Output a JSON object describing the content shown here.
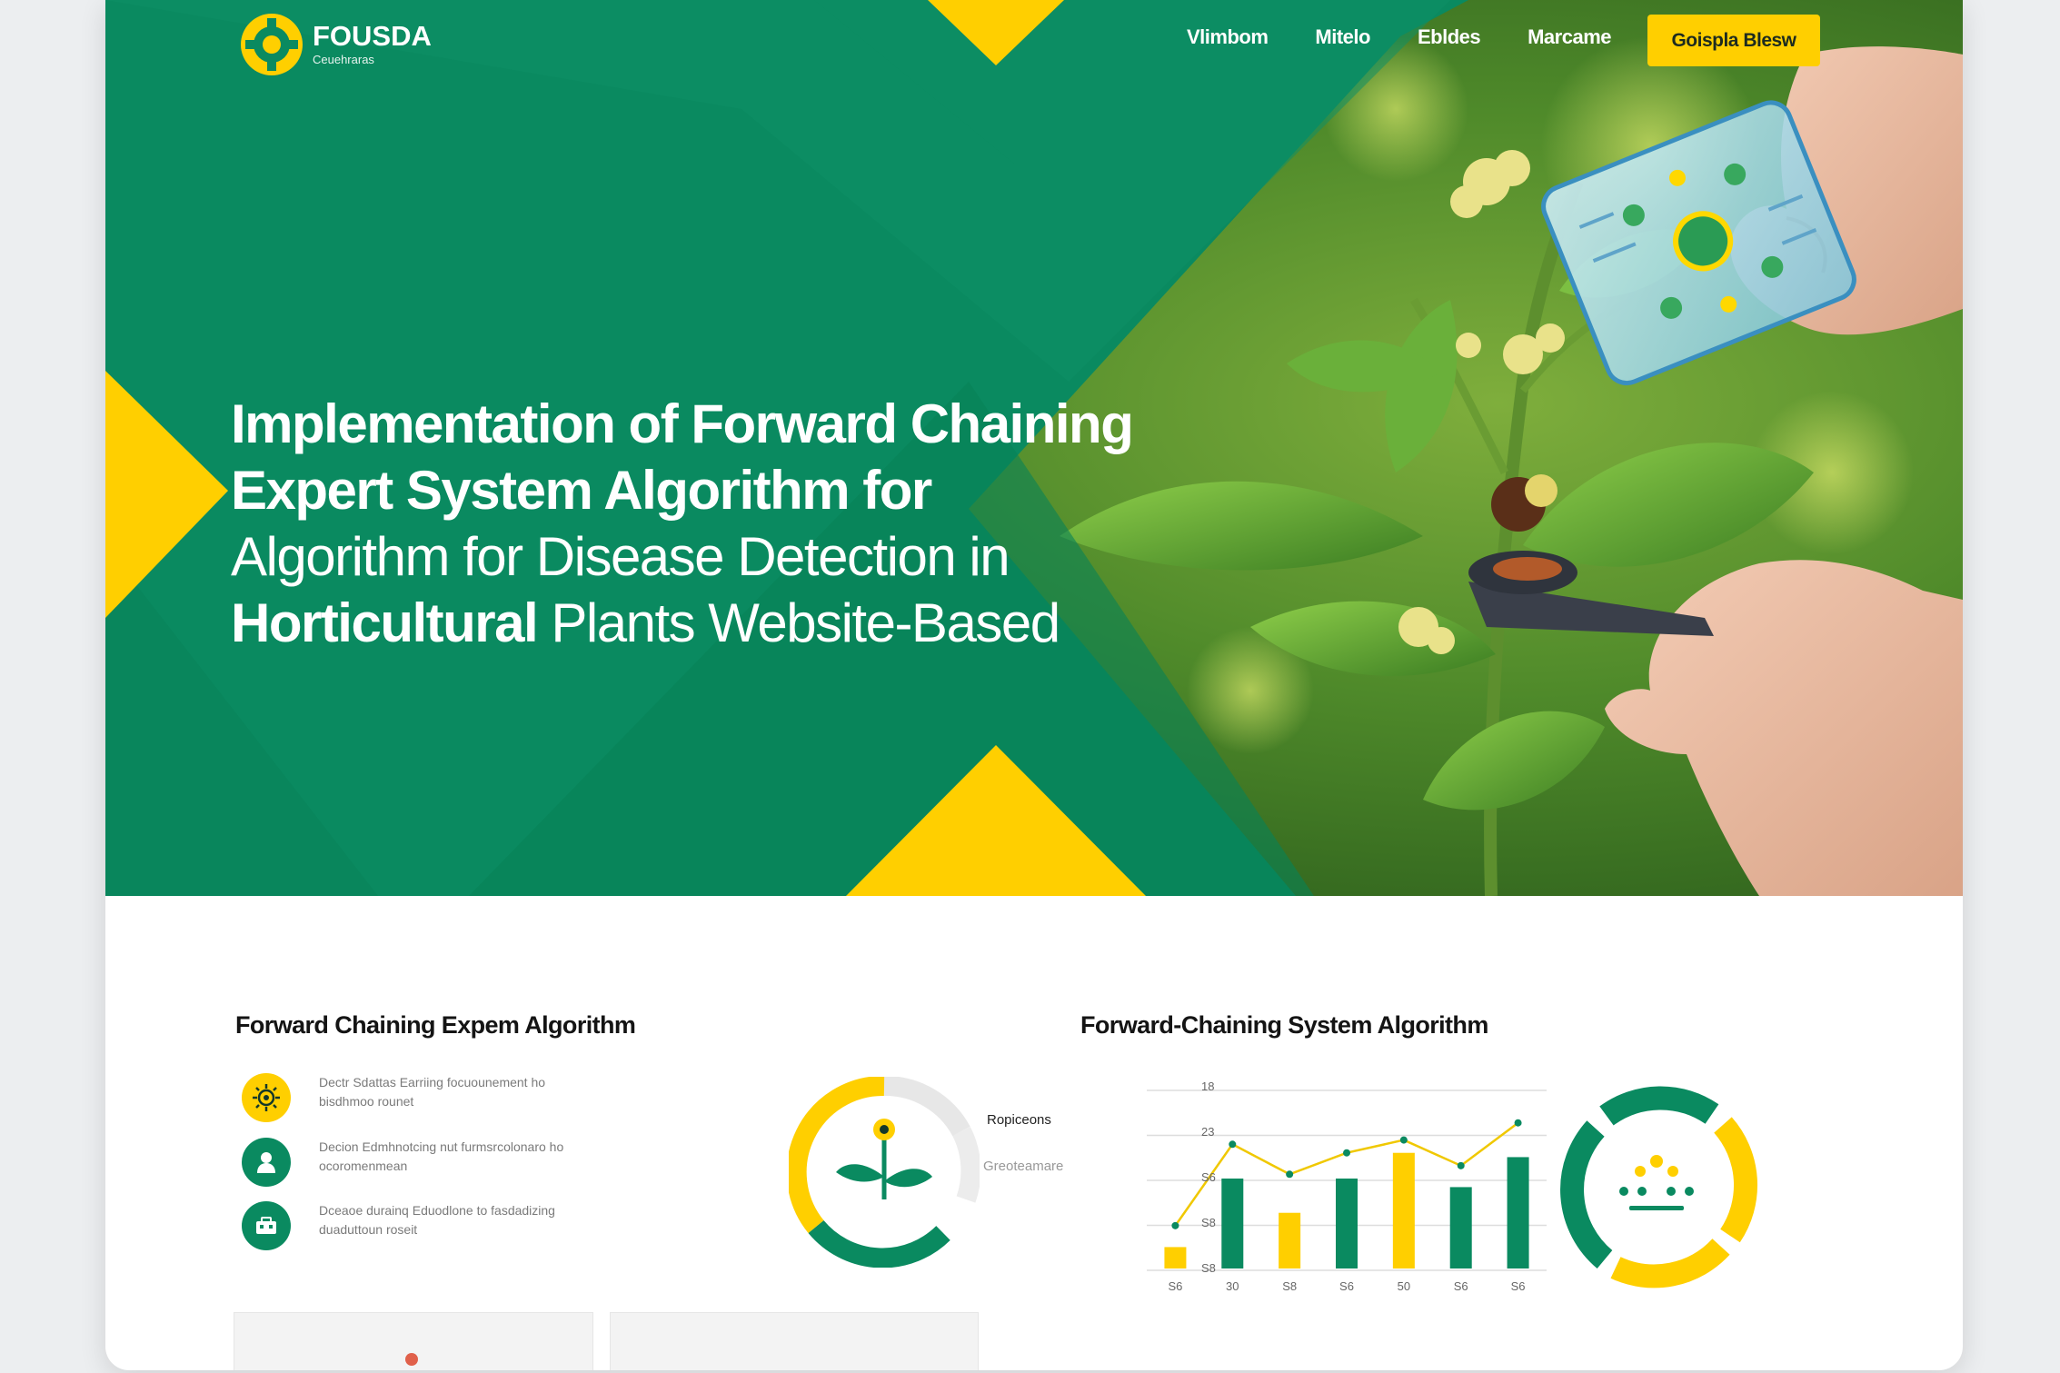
{
  "brand": {
    "name": "FOUSDA",
    "subtitle": "Ceuehraras",
    "colors": {
      "green": "#0a8a60",
      "yellow": "#ffcf00",
      "dark": "#141414"
    }
  },
  "nav": {
    "items": [
      "Vlimbom",
      "Mitelo",
      "Ebldes",
      "Marcame"
    ],
    "cta": "Goispla Blesw"
  },
  "hero": {
    "line1": "Implementation of Forward Chaining",
    "line2": "Expert System Algorithm for",
    "line3": "Algorithm for Disease Detection in",
    "line4_bold": "Horticultural",
    "line4_rest": " Plants Website-Based"
  },
  "left_section": {
    "title": "Forward Chaining Expem Algorithm",
    "features": [
      {
        "icon": "sun-gear-icon",
        "text": "Dectr Sdattas Earriing focuounement ho bisdhmoo rounet"
      },
      {
        "icon": "user-icon",
        "text": "Decion Edmhnotcing nut furmsrcolonaro ho ocoromenmean"
      },
      {
        "icon": "toolbox-icon",
        "text": "Dceaoe durainq Eduodlone to fasdadizing duaduttoun roseit"
      }
    ],
    "ring": {
      "label_1": "Ropiceons",
      "label_2": "Greoteamare"
    }
  },
  "right_section": {
    "title": "Forward-Chaining System Algorithm"
  },
  "chart_data": {
    "type": "bar",
    "categories": [
      "S6",
      "30",
      "S8",
      "S6",
      "50",
      "S6",
      "S6"
    ],
    "series": [
      {
        "values": [
          0.5,
          2.1,
          1.3,
          2.1,
          2.7,
          1.9,
          2.6
        ],
        "colors": [
          "#ffcf00",
          "#0a8a60",
          "#ffcf00",
          "#0a8a60",
          "#ffcf00",
          "#0a8a60",
          "#0a8a60"
        ]
      },
      {
        "type": "line",
        "values": [
          1.0,
          2.9,
          2.2,
          2.7,
          3.0,
          2.4,
          3.4
        ],
        "color": "#f0c800"
      }
    ],
    "yticks": [
      "18",
      "23",
      "S6",
      "S8",
      "S8"
    ],
    "ylim": [
      0,
      4.2
    ],
    "grid": true
  }
}
